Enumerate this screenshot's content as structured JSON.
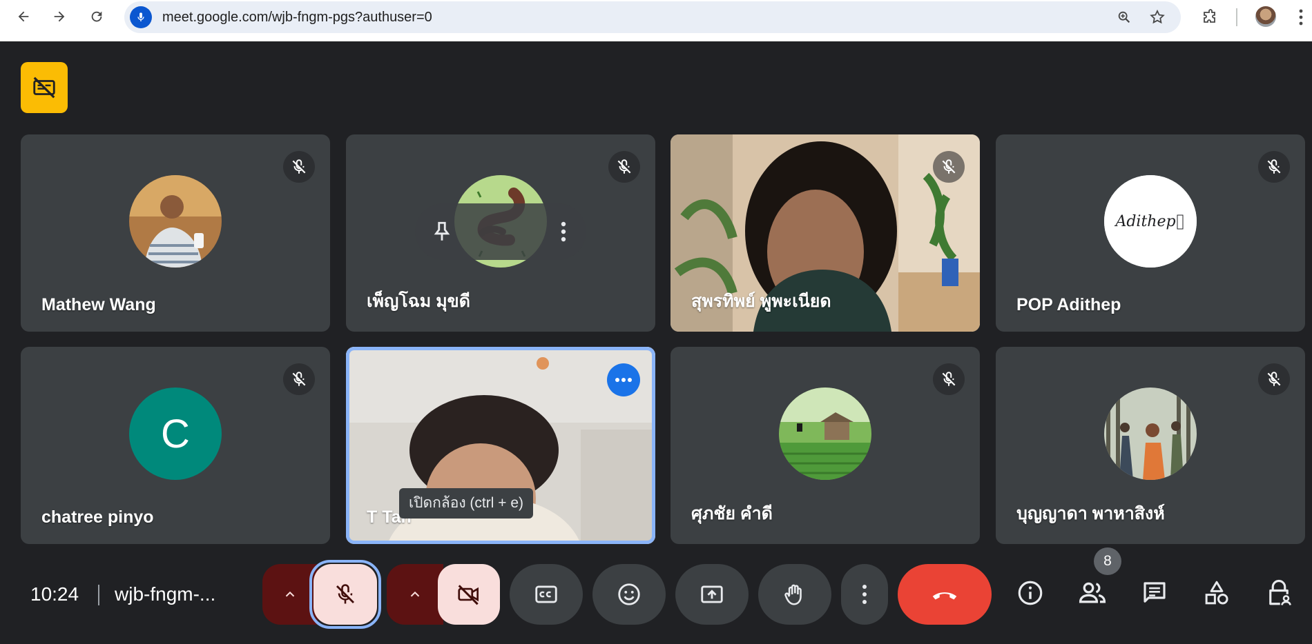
{
  "browser": {
    "url": "meet.google.com/wjb-fngm-pgs?authuser=0"
  },
  "tooltip": {
    "text": "เปิดกล้อง (ctrl + e)"
  },
  "participants": [
    {
      "name": "Mathew Wang",
      "muted": true,
      "display": "photo-avatar"
    },
    {
      "name": "เพ็ญโฉม มุขดี",
      "muted": true,
      "display": "illustration-avatar"
    },
    {
      "name": "สุพรทิพย์ พูพะเนียด",
      "muted": true,
      "display": "video"
    },
    {
      "name": "POP Adithep",
      "muted": true,
      "display": "logo-avatar",
      "avatar_text": "Adithep"
    },
    {
      "name": "chatree pinyo",
      "muted": true,
      "display": "initial-avatar",
      "initial": "C"
    },
    {
      "name": "T Tan",
      "muted": false,
      "display": "video"
    },
    {
      "name": "ศุภชัย คำดี",
      "muted": true,
      "display": "landscape-avatar"
    },
    {
      "name": "บุญญาดา พาหาสิงห์",
      "muted": true,
      "display": "photo-avatar"
    }
  ],
  "controls": {
    "clock": "10:24",
    "meeting_code": "wjb-fngm-...",
    "participant_count": "8"
  },
  "colors": {
    "accent_blue": "#8ab4f8",
    "leave_red": "#ea4335",
    "tile_bg": "#3c4043",
    "initial_avatar_bg": "#00897b",
    "corner_badge": "#fbbc04"
  },
  "icons": {
    "corner_badge": "no-captions-icon",
    "mute": "mic-off-icon",
    "leave": "call-end-icon"
  }
}
